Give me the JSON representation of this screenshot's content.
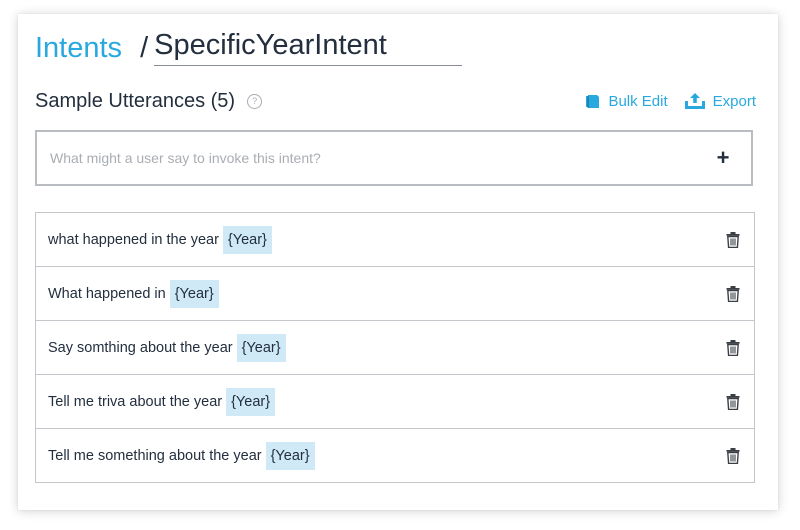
{
  "breadcrumb": {
    "parent": "Intents",
    "separator": "/",
    "current": "SpecificYearIntent"
  },
  "section": {
    "title": "Sample Utterances (5)",
    "help_icon": "question-circle-icon"
  },
  "actions": {
    "bulk_edit": {
      "label": "Bulk Edit",
      "icon": "bulk-edit-icon"
    },
    "export": {
      "label": "Export",
      "icon": "upload-icon"
    }
  },
  "input": {
    "value": "",
    "placeholder": "What might a user say to invoke this intent?",
    "add_icon": "plus-icon"
  },
  "utterances": [
    {
      "text": "what happened in the year",
      "slot": "{Year}"
    },
    {
      "text": "What happened in",
      "slot": "{Year}"
    },
    {
      "text": "Say somthing about the year",
      "slot": "{Year}"
    },
    {
      "text": "Tell me triva about the year",
      "slot": "{Year}"
    },
    {
      "text": "Tell me something about the year",
      "slot": "{Year}"
    }
  ],
  "colors": {
    "accent": "#29a8e0",
    "text": "#232f3e",
    "slot_background": "#cfe9f7",
    "border": "#c3c6ca"
  }
}
